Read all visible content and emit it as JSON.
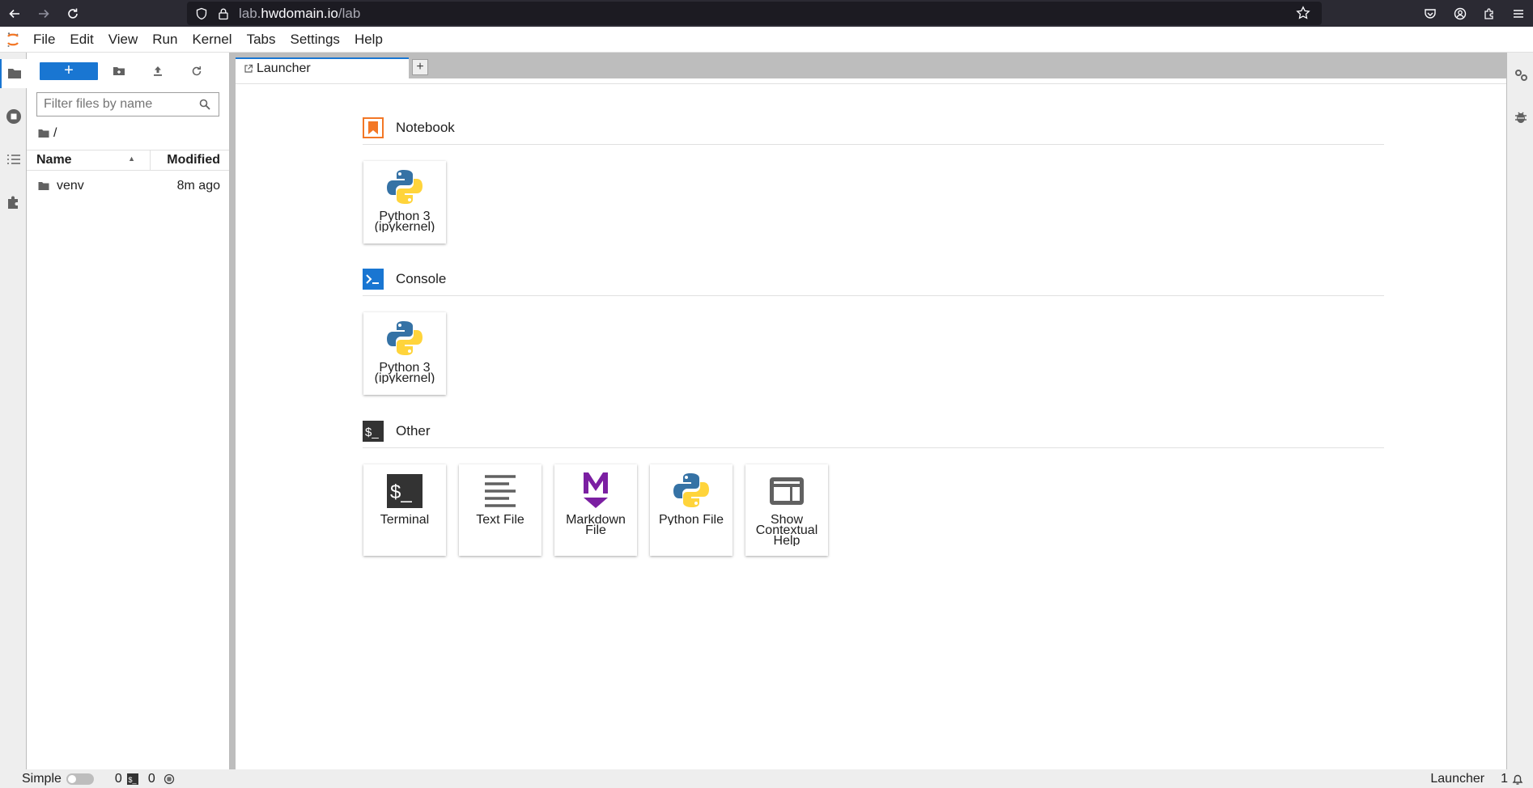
{
  "browser": {
    "url_prefix": "lab.",
    "url_domain": "hwdomain.io",
    "url_path": "/lab"
  },
  "menu": {
    "items": [
      "File",
      "Edit",
      "View",
      "Run",
      "Kernel",
      "Tabs",
      "Settings",
      "Help"
    ]
  },
  "file_browser": {
    "new_button_label": "+",
    "filter_placeholder": "Filter files by name",
    "breadcrumb": "/",
    "header_name": "Name",
    "header_modified": "Modified",
    "files": [
      {
        "name": "venv",
        "modified": "8m ago",
        "icon": "folder-icon"
      }
    ]
  },
  "tabs": [
    {
      "label": "Launcher",
      "icon": "launcher-icon",
      "active": true
    }
  ],
  "add_tab_label": "+",
  "launcher": {
    "sections": [
      {
        "title": "Notebook",
        "icon": "notebook-icon",
        "cards": [
          {
            "label": "Python 3 (ipykernel)",
            "icon": "python-logo-icon"
          }
        ]
      },
      {
        "title": "Console",
        "icon": "console-icon",
        "cards": [
          {
            "label": "Python 3 (ipykernel)",
            "icon": "python-logo-icon"
          }
        ]
      },
      {
        "title": "Other",
        "icon": "terminal-icon",
        "cards": [
          {
            "label": "Terminal",
            "icon": "terminal-icon"
          },
          {
            "label": "Text File",
            "icon": "text-file-icon"
          },
          {
            "label": "Markdown File",
            "icon": "markdown-icon"
          },
          {
            "label": "Python File",
            "icon": "python-logo-icon"
          },
          {
            "label": "Show Contextual Help",
            "icon": "contextual-help-icon"
          }
        ]
      }
    ]
  },
  "status": {
    "simple_label": "Simple",
    "kernels_count": "0",
    "terminals_count": "0",
    "current_activity": "Launcher",
    "notification_count": "1"
  },
  "colors": {
    "accent_blue": "#1976d2",
    "notebook_orange": "#f37726",
    "markdown_purple": "#7b1fa2"
  }
}
